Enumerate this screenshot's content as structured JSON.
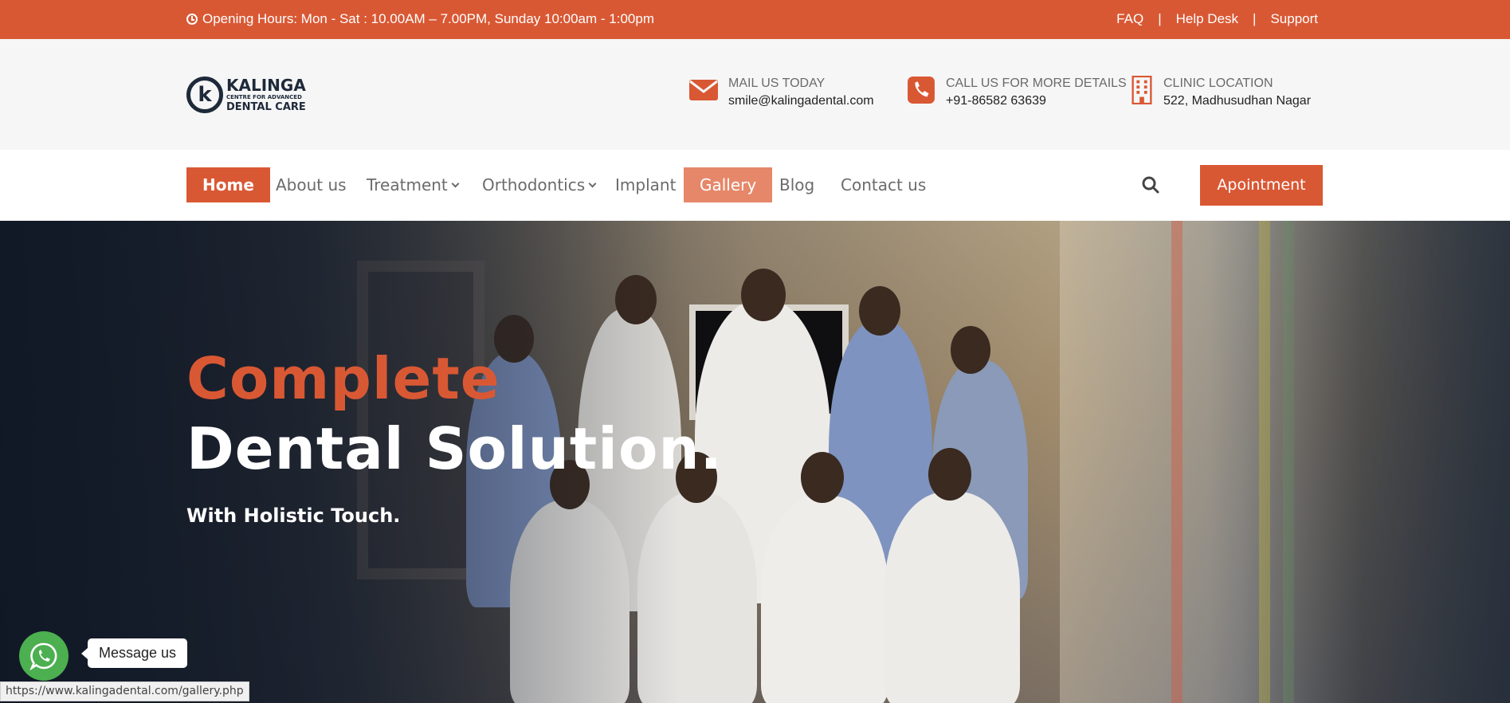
{
  "topbar": {
    "hours": "Opening Hours: Mon - Sat : 10.00AM – 7.00PM, Sunday 10:00am - 1:00pm",
    "links": [
      "FAQ",
      "|",
      "Help Desk",
      "|",
      "Support"
    ]
  },
  "logo": {
    "line1": "KALINGA",
    "line2": "CENTRE FOR ADVANCED",
    "line3": "DENTAL CARE",
    "mark": "k"
  },
  "contacts": {
    "mail": {
      "label": "MAIL US TODAY",
      "value": "smile@kalingadental.com",
      "icon": "mail-icon"
    },
    "call": {
      "label": "CALL US FOR MORE DETAILS",
      "value": "+91-86582 63639",
      "icon": "phone-icon"
    },
    "location": {
      "label": "CLINIC LOCATION",
      "value": "522, Madhusudhan Nagar",
      "icon": "building-icon"
    }
  },
  "nav": {
    "items": [
      {
        "label": "Home"
      },
      {
        "label": "About us"
      },
      {
        "label": "Treatment"
      },
      {
        "label": "Orthodontics"
      },
      {
        "label": "Implant"
      },
      {
        "label": "Gallery"
      },
      {
        "label": "Blog"
      },
      {
        "label": "Contact us"
      }
    ],
    "appointment": "Apointment"
  },
  "hero": {
    "title_line1": "Complete",
    "title_line2": "Dental Solution.",
    "subtitle": "With Holistic Touch."
  },
  "whatsapp": {
    "message": "Message us"
  },
  "status_url": "https://www.kalingadental.com/gallery.php",
  "colors": {
    "accent": "#d95834",
    "accent_light": "#e6876a",
    "whatsapp": "#4caf50",
    "dark": "#1e2a3a"
  }
}
